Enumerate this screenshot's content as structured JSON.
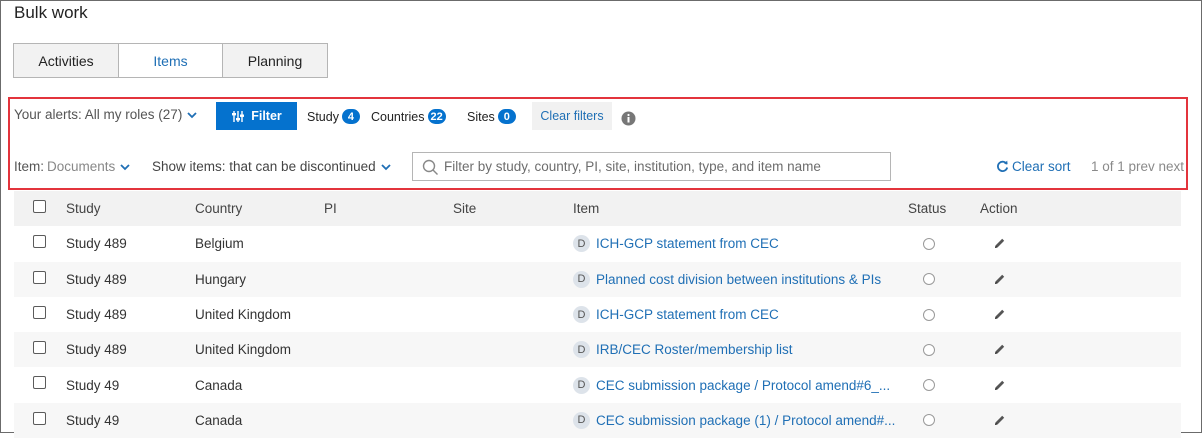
{
  "page": {
    "title": "Bulk work"
  },
  "tabs": [
    {
      "label": "Activities",
      "active": false
    },
    {
      "label": "Items",
      "active": true
    },
    {
      "label": "Planning",
      "active": false
    }
  ],
  "alerts": {
    "label": "Your alerts: All my roles (27)"
  },
  "filter_button": {
    "label": "Filter"
  },
  "chips": [
    {
      "label": "Study",
      "count": "4"
    },
    {
      "label": "Countries",
      "count": "22"
    },
    {
      "label": "Sites",
      "count": "0"
    }
  ],
  "clear_filters": {
    "label": "Clear filters"
  },
  "item_filter": {
    "label": "Item:",
    "value": "Documents"
  },
  "show_items": {
    "label": "Show items: that can be discontinued"
  },
  "search": {
    "placeholder": "Filter by study, country, PI, site, institution, type, and item name",
    "value": ""
  },
  "clear_sort": {
    "label": "Clear sort"
  },
  "pager": {
    "label": "1 of 1 prev next"
  },
  "table": {
    "columns": [
      "Study",
      "Country",
      "PI",
      "Site",
      "Item",
      "Status",
      "Action"
    ],
    "rows": [
      {
        "study": "Study 489",
        "country": "Belgium",
        "pi": "",
        "site": "",
        "type": "D",
        "item": "ICH-GCP statement from CEC"
      },
      {
        "study": "Study 489",
        "country": "Hungary",
        "pi": "",
        "site": "",
        "type": "D",
        "item": "Planned cost division between institutions & PIs"
      },
      {
        "study": "Study 489",
        "country": "United Kingdom",
        "pi": "",
        "site": "",
        "type": "D",
        "item": "ICH-GCP statement from CEC"
      },
      {
        "study": "Study 489",
        "country": "United Kingdom",
        "pi": "",
        "site": "",
        "type": "D",
        "item": "IRB/CEC Roster/membership list"
      },
      {
        "study": "Study 49",
        "country": "Canada",
        "pi": "",
        "site": "",
        "type": "D",
        "item": "CEC submission package / Protocol amend#6_..."
      },
      {
        "study": "Study 49",
        "country": "Canada",
        "pi": "",
        "site": "",
        "type": "D",
        "item": "CEC submission package (1) / Protocol amend#..."
      }
    ]
  },
  "colors": {
    "accent": "#0572ce",
    "link": "#1f6fb5",
    "highlight_border": "#e3343c"
  },
  "icons": {
    "filter": "sliders-icon",
    "info": "info-icon",
    "search": "search-icon",
    "sort": "refresh-icon",
    "edit": "pencil-icon"
  }
}
